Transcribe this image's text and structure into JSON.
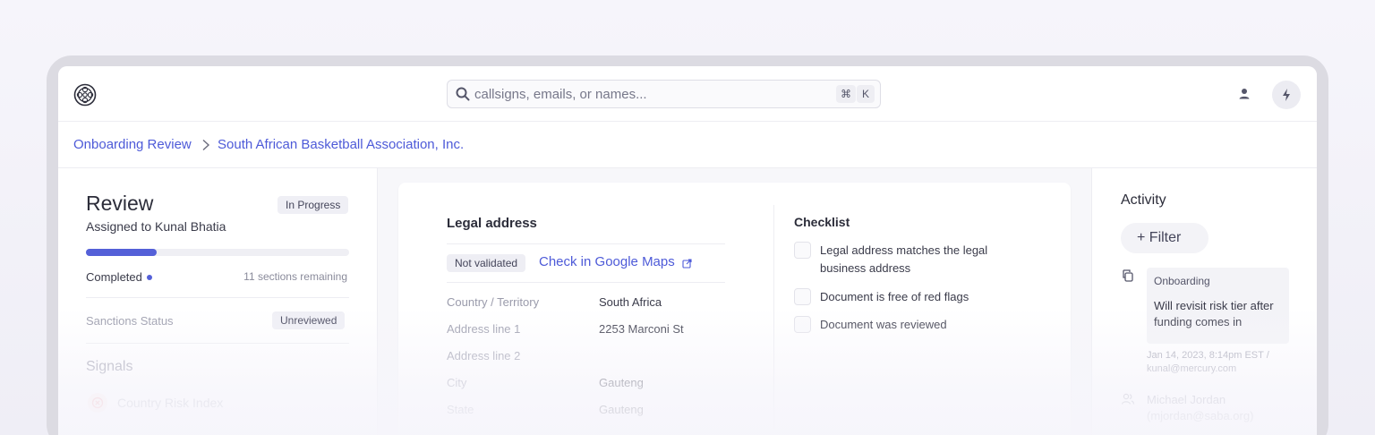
{
  "search": {
    "placeholder": "callsigns, emails, or names...",
    "shortcut_key1": "⌘",
    "shortcut_key2": "K"
  },
  "breadcrumb": {
    "parent": "Onboarding Review",
    "current": "South African Basketball Association, Inc."
  },
  "review": {
    "title": "Review",
    "status": "In Progress",
    "assigned": "Assigned to Kunal Bhatia",
    "progress_fraction": 0.27,
    "completed_label": "Completed",
    "remaining": "11 sections remaining",
    "sanctions_label": "Sanctions Status",
    "sanctions_status": "Unreviewed",
    "signals_title": "Signals",
    "signals": [
      {
        "label": "Country Risk Index"
      }
    ]
  },
  "legal_address": {
    "title": "Legal address",
    "validation_status": "Not validated",
    "maps_link": "Check in Google Maps",
    "fields": [
      {
        "label": "Country / Territory",
        "value": "South Africa"
      },
      {
        "label": "Address line 1",
        "value": "2253 Marconi St"
      },
      {
        "label": "Address line 2",
        "value": ""
      },
      {
        "label": "City",
        "value": "Gauteng"
      },
      {
        "label": "State",
        "value": "Gauteng"
      }
    ]
  },
  "checklist": {
    "title": "Checklist",
    "items": [
      {
        "label": "Legal address matches the legal business address",
        "checked": false
      },
      {
        "label": "Document is free of red flags",
        "checked": false
      },
      {
        "label": "Document was reviewed",
        "checked": false
      }
    ]
  },
  "activity": {
    "title": "Activity",
    "filter_label": "+ Filter",
    "note": {
      "tag": "Onboarding",
      "text": "Will revisit risk tier after funding comes in",
      "meta": "Jan 14, 2023, 8:14pm EST / kunal@mercury.com"
    },
    "person": {
      "name": "Michael Jordan",
      "handle": "(mjordan@saba.org)"
    }
  },
  "colors": {
    "accent": "#5460d8",
    "link": "#4d5ad8",
    "danger_soft": "#fdeeee"
  },
  "icons": [
    "logo-icon",
    "search-icon",
    "user-icon",
    "bolt-icon",
    "chevron-right-icon",
    "external-link-icon",
    "copy-icon",
    "people-icon",
    "error-circle-icon"
  ]
}
